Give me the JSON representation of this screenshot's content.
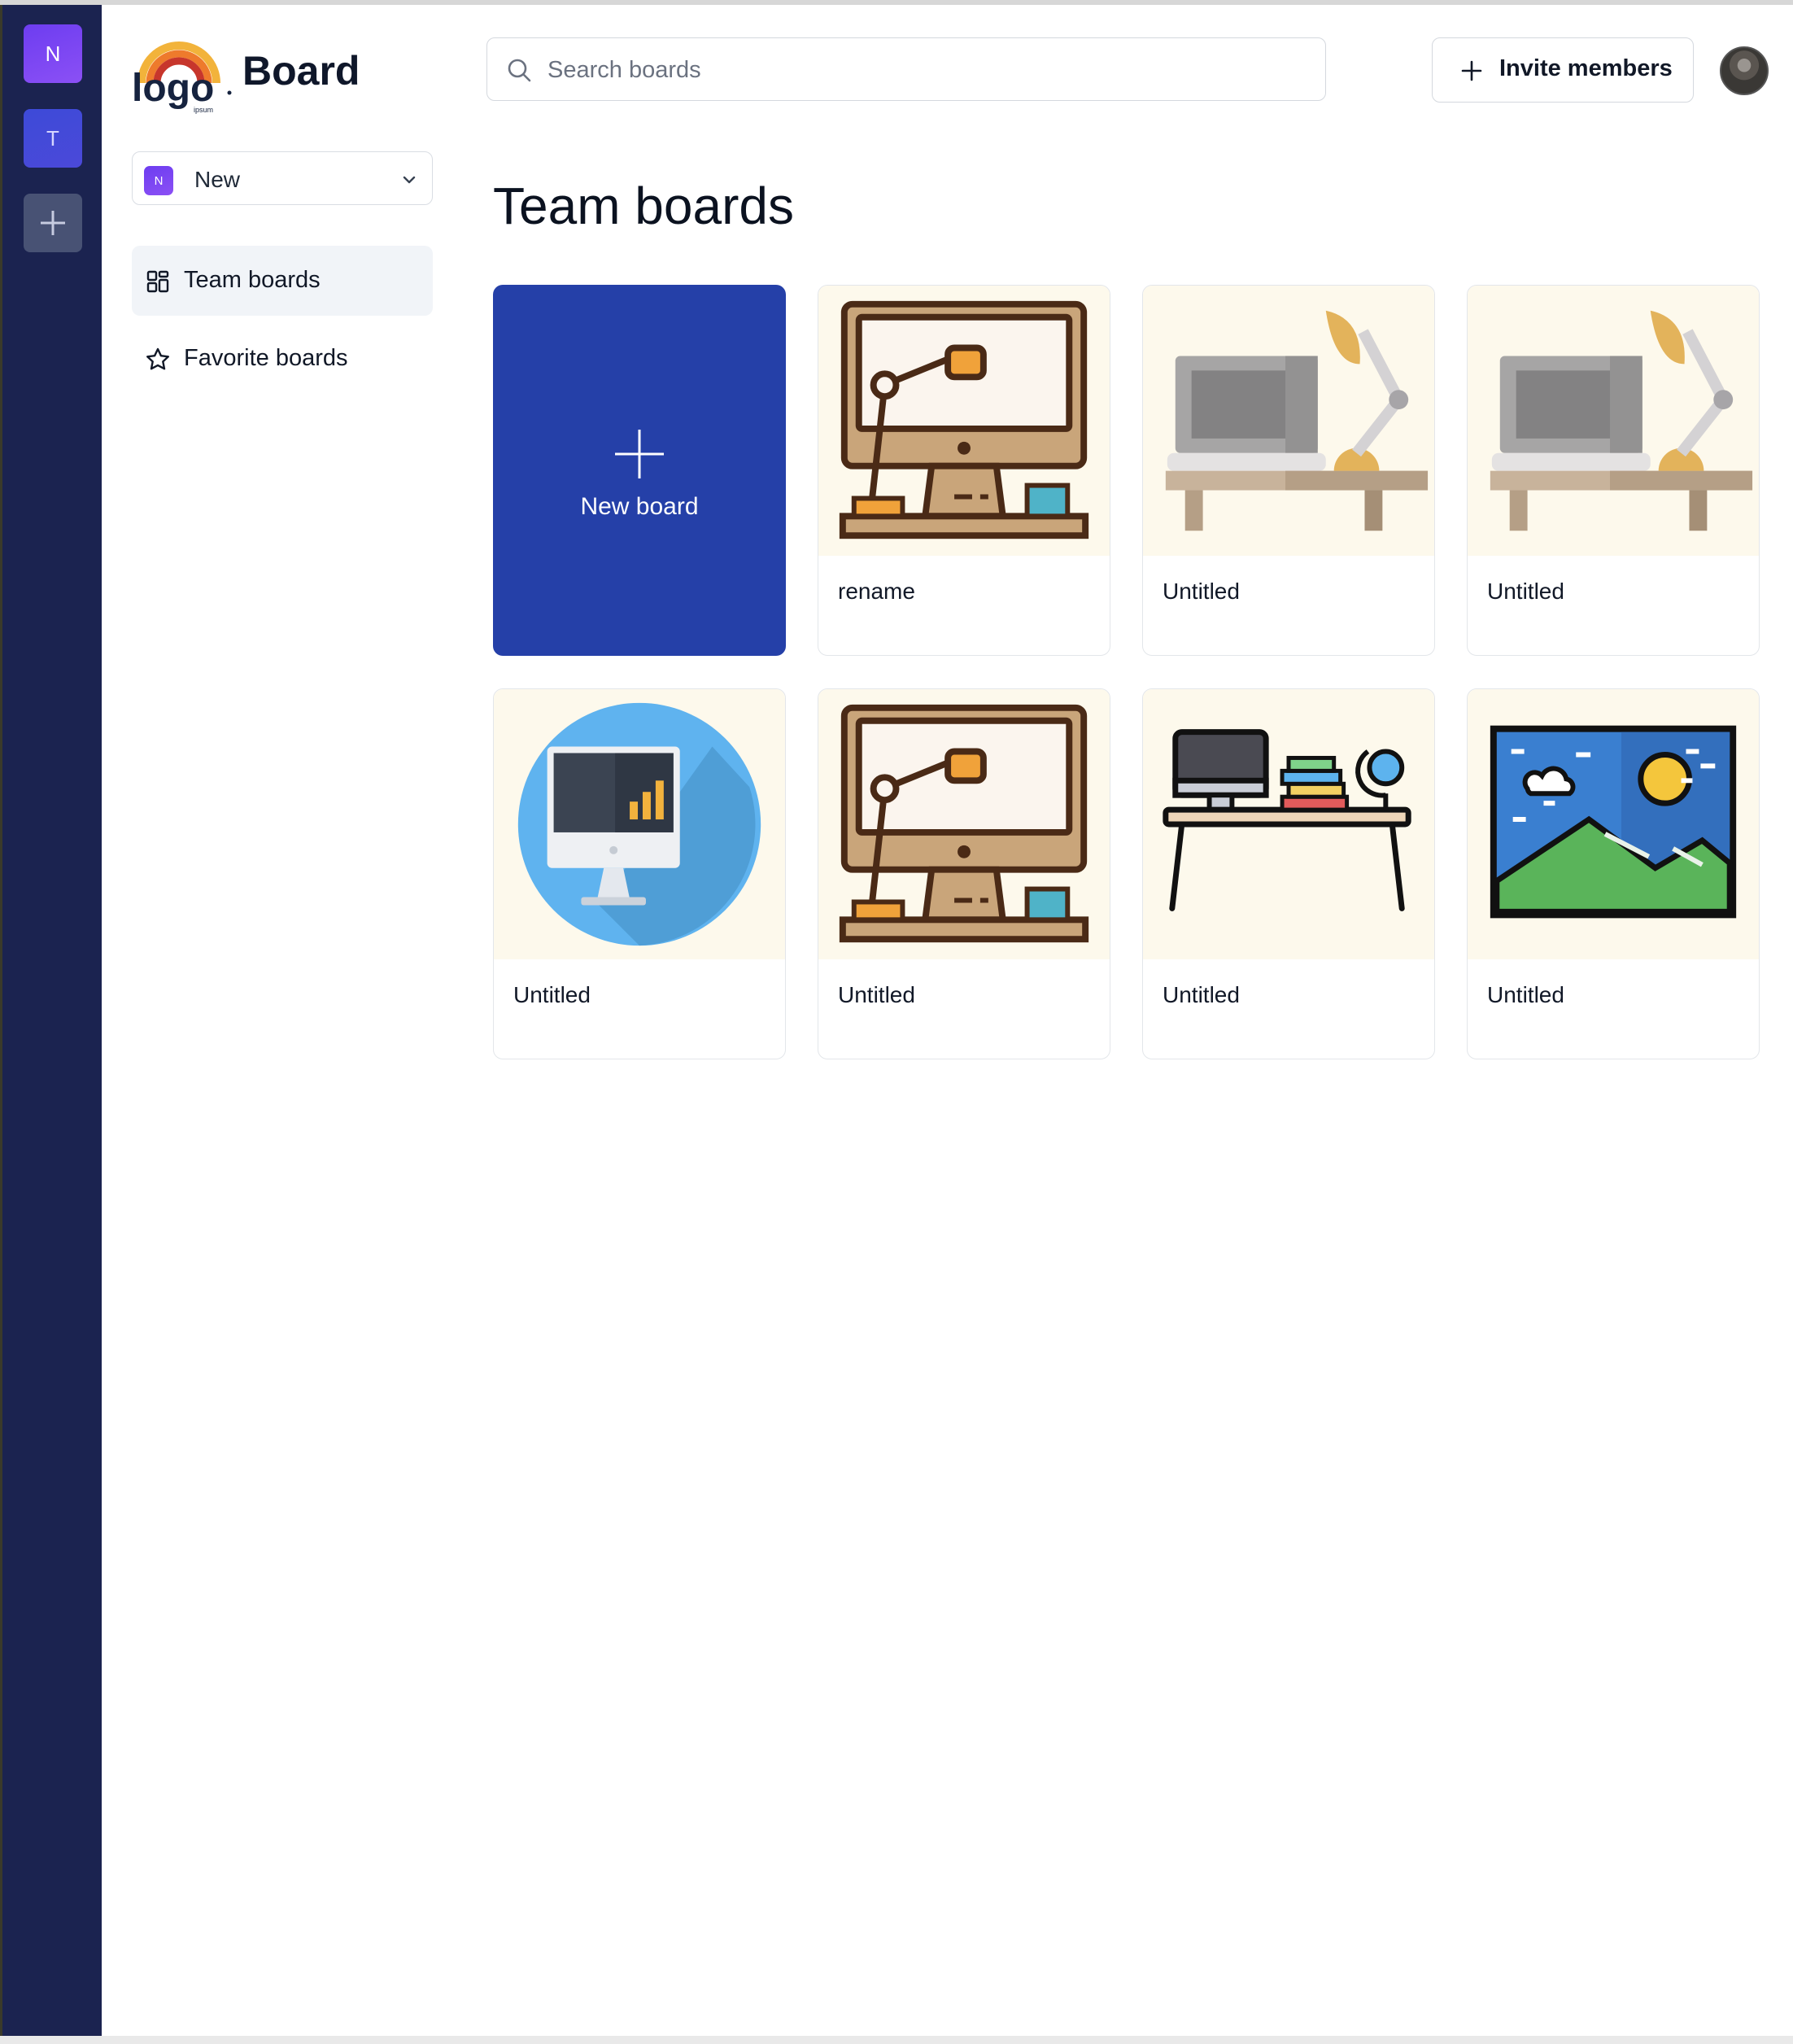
{
  "rail": {
    "workspaces": [
      {
        "initial": "N"
      },
      {
        "initial": "T"
      }
    ],
    "add_icon": "plus-icon"
  },
  "header": {
    "logo_text": "logo",
    "logo_subtext": "ipsum",
    "app_title": "Board",
    "search": {
      "placeholder": "Search boards",
      "value": "",
      "icon": "search-icon"
    },
    "invite_label": "Invite members"
  },
  "sidebar": {
    "workspace_select": {
      "badge": "N",
      "label": "New"
    },
    "items": [
      {
        "label": "Team boards",
        "icon": "grid-icon",
        "active": true
      },
      {
        "label": "Favorite boards",
        "icon": "star-icon",
        "active": false
      }
    ]
  },
  "main": {
    "title": "Team boards",
    "new_board_label": "New board",
    "boards": [
      {
        "name": "rename",
        "image": "desk-lamp-monitor-icon"
      },
      {
        "name": "Untitled",
        "image": "laptop-lamp-desk-icon"
      },
      {
        "name": "Untitled",
        "image": "laptop-lamp-desk-icon"
      },
      {
        "name": "Untitled",
        "image": "monitor-chart-icon"
      },
      {
        "name": "Untitled",
        "image": "desk-lamp-monitor-icon"
      },
      {
        "name": "Untitled",
        "image": "desk-books-globe-icon"
      },
      {
        "name": "Untitled",
        "image": "landscape-picture-icon"
      }
    ]
  },
  "colors": {
    "rail": "#1b2350",
    "accent": "#2540a8",
    "workspace_n": "#7a45f2",
    "workspace_t": "#4348d8",
    "card_thumb_bg": "#fdf9ec"
  }
}
